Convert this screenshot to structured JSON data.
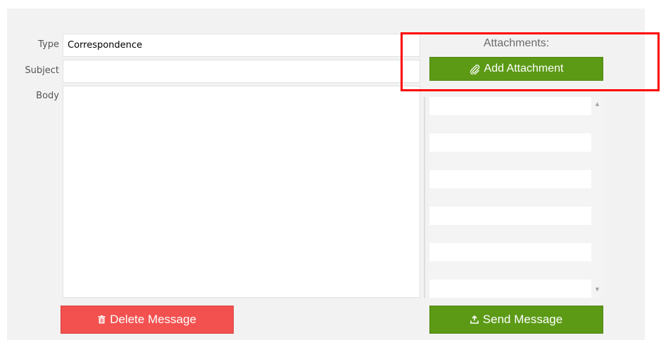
{
  "form": {
    "type_label": "Type",
    "type_value": "Correspondence",
    "subject_label": "Subject",
    "subject_value": "",
    "body_label": "Body",
    "body_value": ""
  },
  "attachments": {
    "title": "Attachments:",
    "add_button_label": "Add Attachment",
    "rows": [
      "",
      "",
      "",
      "",
      "",
      ""
    ]
  },
  "actions": {
    "delete_label": "Delete Message",
    "send_label": "Send Message"
  },
  "colors": {
    "green": "#5c9a16",
    "red": "#f2514f",
    "highlight": "#ff0000"
  },
  "icons": {
    "paperclip": "paperclip-icon",
    "trash": "trash-icon",
    "upload": "upload-icon"
  }
}
